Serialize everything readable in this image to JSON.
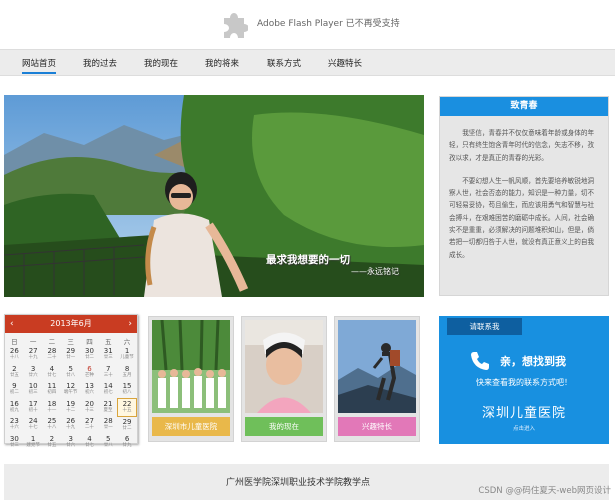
{
  "flash": {
    "message": "Adobe Flash Player 已不再受支持"
  },
  "nav": {
    "items": [
      {
        "label": "网站首页"
      },
      {
        "label": "我的过去"
      },
      {
        "label": "我的现在"
      },
      {
        "label": "我的将来"
      },
      {
        "label": "联系方式"
      },
      {
        "label": "兴趣特长"
      }
    ]
  },
  "hero": {
    "quote": "最求我想要的一切",
    "signature": "——永远铭记"
  },
  "youth": {
    "title": "致青春",
    "paragraphs": [
      "我坚信，青春并不仅仅意味着年龄或身体的年轻，只有终生饱含青年时代的信念，矢志不移，孜孜以求，才是真正的青春的光彩。",
      "不要幻想人生一帆风顺，首先要培养敏锐地洞察人世，社会否态的能力，知识是一种力量，切不可轻易妥协，苟且偷生，而应该用勇气和智慧与社会搏斗，在艰难困苦的磨砺中成长。人间，社会确实不是重重，必须解决的问题堆积如山，但是，倘若把一切都归咎于人世，就没有真正意义上的自我成长。"
    ]
  },
  "calendar": {
    "title": "2013年6月",
    "prev": "‹",
    "next": "›",
    "weekdays": [
      "日",
      "一",
      "二",
      "三",
      "四",
      "五",
      "六"
    ],
    "weeks": [
      [
        {
          "d": "26",
          "s": "十八"
        },
        {
          "d": "27",
          "s": "十九"
        },
        {
          "d": "28",
          "s": "二十"
        },
        {
          "d": "29",
          "s": "廿一"
        },
        {
          "d": "30",
          "s": "廿二"
        },
        {
          "d": "31",
          "s": "廿三"
        },
        {
          "d": "1",
          "s": "儿童节"
        }
      ],
      [
        {
          "d": "2",
          "s": "廿五"
        },
        {
          "d": "3",
          "s": "廿六"
        },
        {
          "d": "4",
          "s": "廿七"
        },
        {
          "d": "5",
          "s": "廿八"
        },
        {
          "d": "6",
          "s": "芒种"
        },
        {
          "d": "7",
          "s": "三十"
        },
        {
          "d": "8",
          "s": "五月"
        }
      ],
      [
        {
          "d": "9",
          "s": "初二"
        },
        {
          "d": "10",
          "s": "初三"
        },
        {
          "d": "11",
          "s": "初四"
        },
        {
          "d": "12",
          "s": "端午节"
        },
        {
          "d": "13",
          "s": "初六"
        },
        {
          "d": "14",
          "s": "初七"
        },
        {
          "d": "15",
          "s": "初八"
        }
      ],
      [
        {
          "d": "16",
          "s": "初九"
        },
        {
          "d": "17",
          "s": "初十"
        },
        {
          "d": "18",
          "s": "十一"
        },
        {
          "d": "19",
          "s": "十二"
        },
        {
          "d": "20",
          "s": "十三"
        },
        {
          "d": "21",
          "s": "夏至"
        },
        {
          "d": "22",
          "s": "十五"
        }
      ],
      [
        {
          "d": "23",
          "s": "十六"
        },
        {
          "d": "24",
          "s": "十七"
        },
        {
          "d": "25",
          "s": "十八"
        },
        {
          "d": "26",
          "s": "十九"
        },
        {
          "d": "27",
          "s": "二十"
        },
        {
          "d": "28",
          "s": "廿一"
        },
        {
          "d": "29",
          "s": "廿二"
        }
      ],
      [
        {
          "d": "30",
          "s": "廿三"
        },
        {
          "d": "1",
          "s": "建党节"
        },
        {
          "d": "2",
          "s": "廿五"
        },
        {
          "d": "3",
          "s": "廿六"
        },
        {
          "d": "4",
          "s": "廿七"
        },
        {
          "d": "5",
          "s": "廿八"
        },
        {
          "d": "6",
          "s": "廿九"
        }
      ]
    ]
  },
  "cards": [
    {
      "label": "深圳市儿童医院",
      "color": "#e9b84a"
    },
    {
      "label": "我的现在",
      "color": "#6fbf5a"
    },
    {
      "label": "兴趣特长",
      "color": "#e278b8"
    }
  ],
  "contact": {
    "tab": "请联系我",
    "line1": "亲，想找到我",
    "line2": "快来查看我的联系方式吧！",
    "line3": "深圳儿童医院",
    "link": "点击进入"
  },
  "footer": {
    "text": "广州医学院深圳职业技术学院教学点"
  },
  "watermark": "CSDN @@码住夏天-web网页设计"
}
